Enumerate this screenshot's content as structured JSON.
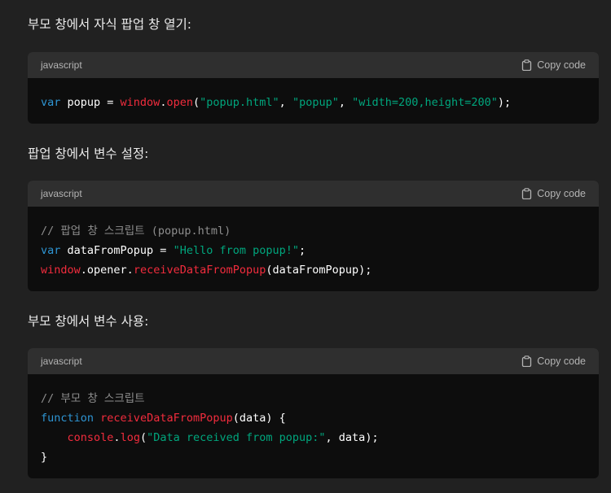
{
  "sections": [
    {
      "heading": "부모 창에서 자식 팝업 창 열기:",
      "lang": "javascript",
      "copy_label": "Copy code",
      "code_lines": [
        [
          {
            "t": "var",
            "c": "kw"
          },
          {
            "t": " popup = ",
            "c": "pl"
          },
          {
            "t": "window",
            "c": "fn"
          },
          {
            "t": ".",
            "c": "pl"
          },
          {
            "t": "open",
            "c": "fn"
          },
          {
            "t": "(",
            "c": "pl"
          },
          {
            "t": "\"popup.html\"",
            "c": "str"
          },
          {
            "t": ", ",
            "c": "pl"
          },
          {
            "t": "\"popup\"",
            "c": "str"
          },
          {
            "t": ", ",
            "c": "pl"
          },
          {
            "t": "\"width=200,height=200\"",
            "c": "str"
          },
          {
            "t": ");",
            "c": "pl"
          }
        ]
      ]
    },
    {
      "heading": "팝업 창에서 변수 설정:",
      "lang": "javascript",
      "copy_label": "Copy code",
      "code_lines": [
        [
          {
            "t": "// 팝업 창 스크립트 (popup.html)",
            "c": "cm"
          }
        ],
        [
          {
            "t": "var",
            "c": "kw"
          },
          {
            "t": " dataFromPopup = ",
            "c": "pl"
          },
          {
            "t": "\"Hello from popup!\"",
            "c": "str"
          },
          {
            "t": ";",
            "c": "pl"
          }
        ],
        [
          {
            "t": "window",
            "c": "fn"
          },
          {
            "t": ".opener.",
            "c": "pl"
          },
          {
            "t": "receiveDataFromPopup",
            "c": "fn"
          },
          {
            "t": "(dataFromPopup);",
            "c": "pl"
          }
        ]
      ]
    },
    {
      "heading": "부모 창에서 변수 사용:",
      "lang": "javascript",
      "copy_label": "Copy code",
      "code_lines": [
        [
          {
            "t": "// 부모 창 스크립트",
            "c": "cm"
          }
        ],
        [
          {
            "t": "function",
            "c": "kw"
          },
          {
            "t": " ",
            "c": "pl"
          },
          {
            "t": "receiveDataFromPopup",
            "c": "fn"
          },
          {
            "t": "(data) {",
            "c": "pl"
          }
        ],
        [
          {
            "t": "    ",
            "c": "pl"
          },
          {
            "t": "console",
            "c": "fn"
          },
          {
            "t": ".",
            "c": "pl"
          },
          {
            "t": "log",
            "c": "fn"
          },
          {
            "t": "(",
            "c": "pl"
          },
          {
            "t": "\"Data received from popup:\"",
            "c": "str"
          },
          {
            "t": ", data);",
            "c": "pl"
          }
        ],
        [
          {
            "t": "}",
            "c": "pl"
          }
        ]
      ]
    }
  ],
  "icons": {
    "copy": "clipboard-icon"
  },
  "colors": {
    "background": "#212121",
    "code_bg": "#0d0d0d",
    "header_bg": "#2f2f2f",
    "keyword": "#2e95d3",
    "function": "#f22c3d",
    "string": "#00a67d",
    "comment": "#8e8e8e"
  }
}
